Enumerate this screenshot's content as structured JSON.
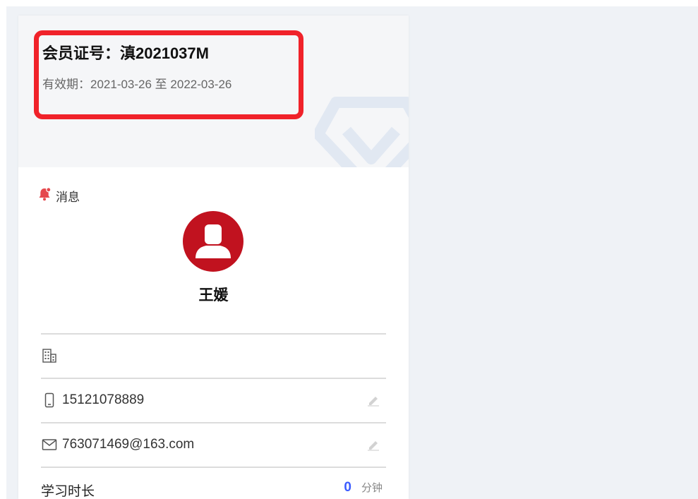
{
  "member": {
    "card_number": "会员证号：滇2021037M",
    "validity": "有效期：2021-03-26 至 2022-03-26"
  },
  "messages": {
    "label": "消息"
  },
  "user": {
    "name": "王媛"
  },
  "contact": {
    "organization": "",
    "phone": "15121078889",
    "email": "763071469@163.com"
  },
  "study": {
    "label": "学习时长",
    "value": "0",
    "unit": "分钟"
  },
  "colors": {
    "highlight": "#f0222a",
    "avatar": "#c1121f",
    "accent": "#3b5bff",
    "bell": "#e5484d"
  },
  "icons": {
    "bell": "bell-icon",
    "building": "building-icon",
    "phone": "phone-icon",
    "email": "mail-icon",
    "edit": "pencil-icon",
    "watermark": "shield-v-icon"
  }
}
